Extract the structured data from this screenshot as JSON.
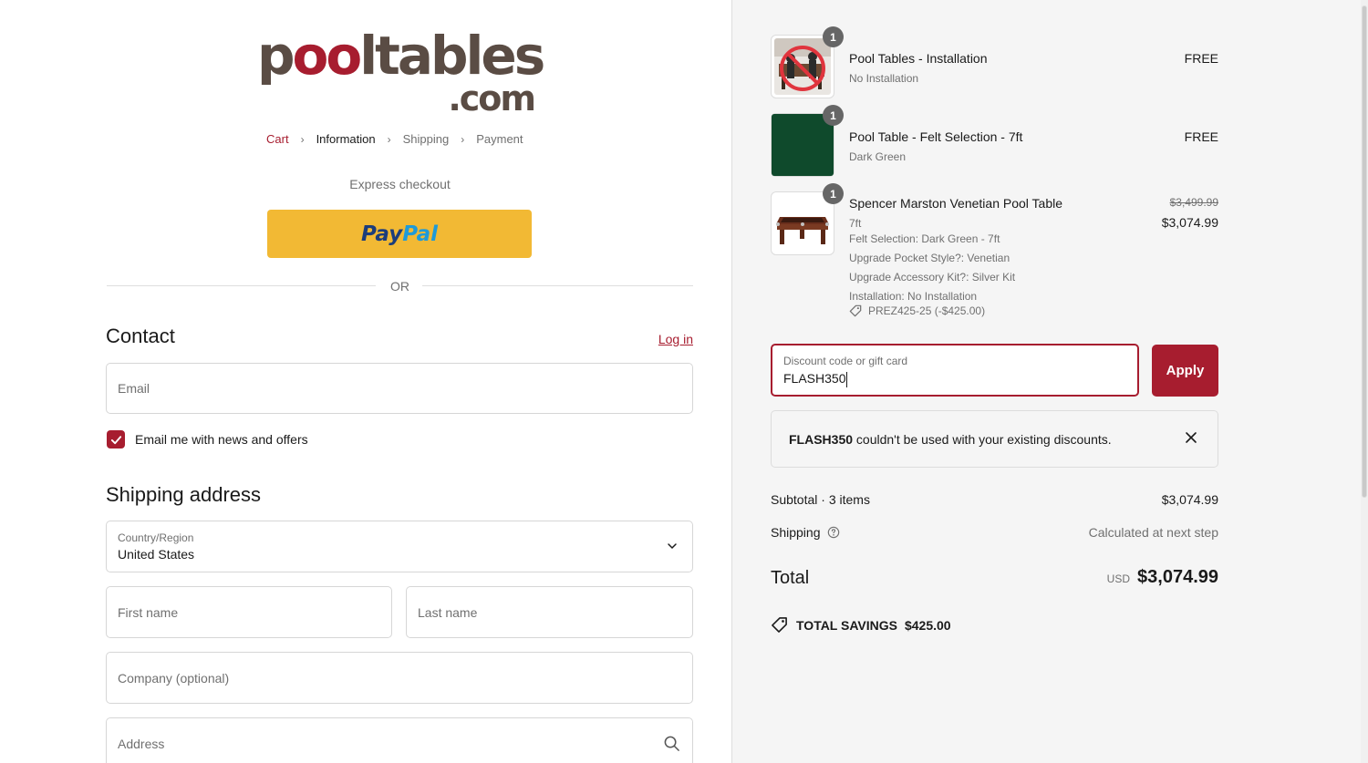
{
  "brand": {
    "logo_parts": [
      "p",
      "oo",
      "ltables"
    ],
    "logo_com": ".com",
    "accent_color": "#a71d2f"
  },
  "breadcrumb": [
    {
      "label": "Cart",
      "state": "link"
    },
    {
      "label": "Information",
      "state": "current"
    },
    {
      "label": "Shipping",
      "state": "upcoming"
    },
    {
      "label": "Payment",
      "state": "upcoming"
    }
  ],
  "express": {
    "label": "Express checkout",
    "paypal_pay": "Pay",
    "paypal_pal": "Pal",
    "or_label": "OR"
  },
  "contact": {
    "title": "Contact",
    "login_label": "Log in",
    "email_placeholder": "Email",
    "newsletter_label": "Email me with news and offers",
    "newsletter_checked": true
  },
  "shipping": {
    "title": "Shipping address",
    "country_label": "Country/Region",
    "country_value": "United States",
    "first_name_placeholder": "First name",
    "last_name_placeholder": "Last name",
    "company_placeholder": "Company (optional)",
    "address_placeholder": "Address"
  },
  "order": {
    "items": [
      {
        "quantity": "1",
        "name": "Pool Tables - Installation",
        "variant": "No Installation",
        "price": "FREE"
      },
      {
        "quantity": "1",
        "name": "Pool Table - Felt Selection - 7ft",
        "variant": "Dark Green",
        "price": "FREE"
      },
      {
        "quantity": "1",
        "name": "Spencer Marston Venetian Pool Table",
        "variant": "7ft",
        "properties": [
          "Felt Selection: Dark Green - 7ft",
          "Upgrade Pocket Style?: Venetian",
          "Upgrade Accessory Kit?: Silver Kit",
          "Installation: No Installation"
        ],
        "discount_tag": "PREZ425-25 (-$425.00)",
        "compare_price": "$3,499.99",
        "price": "$3,074.99"
      }
    ]
  },
  "discount": {
    "label": "Discount code or gift card",
    "value": "FLASH350",
    "apply_label": "Apply"
  },
  "notice": {
    "code": "FLASH350",
    "message": " couldn't be used with your existing discounts."
  },
  "summary": {
    "subtotal_label": "Subtotal · 3 items",
    "subtotal_value": "$3,074.99",
    "shipping_label": "Shipping",
    "shipping_value": "Calculated at next step",
    "total_label": "Total",
    "currency": "USD",
    "total_value": "$3,074.99",
    "savings_label": "TOTAL SAVINGS",
    "savings_value": "$425.00"
  }
}
